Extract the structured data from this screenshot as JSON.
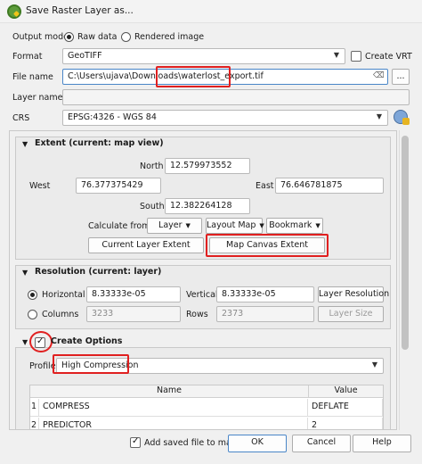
{
  "window": {
    "title": "Save Raster Layer as..."
  },
  "output_mode": {
    "label": "Output mode",
    "raw_label": "Raw data",
    "rendered_label": "Rendered image"
  },
  "format": {
    "label": "Format",
    "value": "GeoTIFF",
    "create_vrt_label": "Create VRT"
  },
  "file_name": {
    "label": "File name",
    "value_prefix": "C:\\Users\\ujava\\Downloads\\",
    "value_highlight": "waterlost_export.tif",
    "browse_label": "..."
  },
  "layer_name": {
    "label": "Layer name",
    "value": ""
  },
  "crs": {
    "label": "CRS",
    "value": "EPSG:4326 - WGS 84"
  },
  "extent": {
    "title": "Extent (current: map view)",
    "north_label": "North",
    "north": "12.579973552",
    "west_label": "West",
    "west": "76.377375429",
    "east_label": "East",
    "east": "76.646781875",
    "south_label": "South",
    "south": "12.382264128",
    "calc_label": "Calculate from",
    "layer_btn": "Layer",
    "layout_btn": "Layout Map",
    "bookmark_btn": "Bookmark",
    "current_layer_btn": "Current Layer Extent",
    "map_canvas_btn": "Map Canvas Extent"
  },
  "resolution": {
    "title": "Resolution (current: layer)",
    "horizontal_label": "Horizontal",
    "horizontal": "8.33333e-05",
    "vertical_label": "Vertical",
    "vertical": "8.33333e-05",
    "layer_res_btn": "Layer Resolution",
    "columns_label": "Columns",
    "columns": "3233",
    "rows_label": "Rows",
    "rows": "2373",
    "layer_size_btn": "Layer Size"
  },
  "create_options": {
    "title": "Create Options",
    "profile_label": "Profile",
    "profile": "High Compression",
    "columns": [
      "Name",
      "Value"
    ],
    "rows": [
      {
        "index": "1",
        "name": "COMPRESS",
        "value": "DEFLATE"
      },
      {
        "index": "2",
        "name": "PREDICTOR",
        "value": "2"
      }
    ]
  },
  "footer": {
    "add_saved_label": "Add saved file to map",
    "ok": "OK",
    "cancel": "Cancel",
    "help": "Help"
  }
}
